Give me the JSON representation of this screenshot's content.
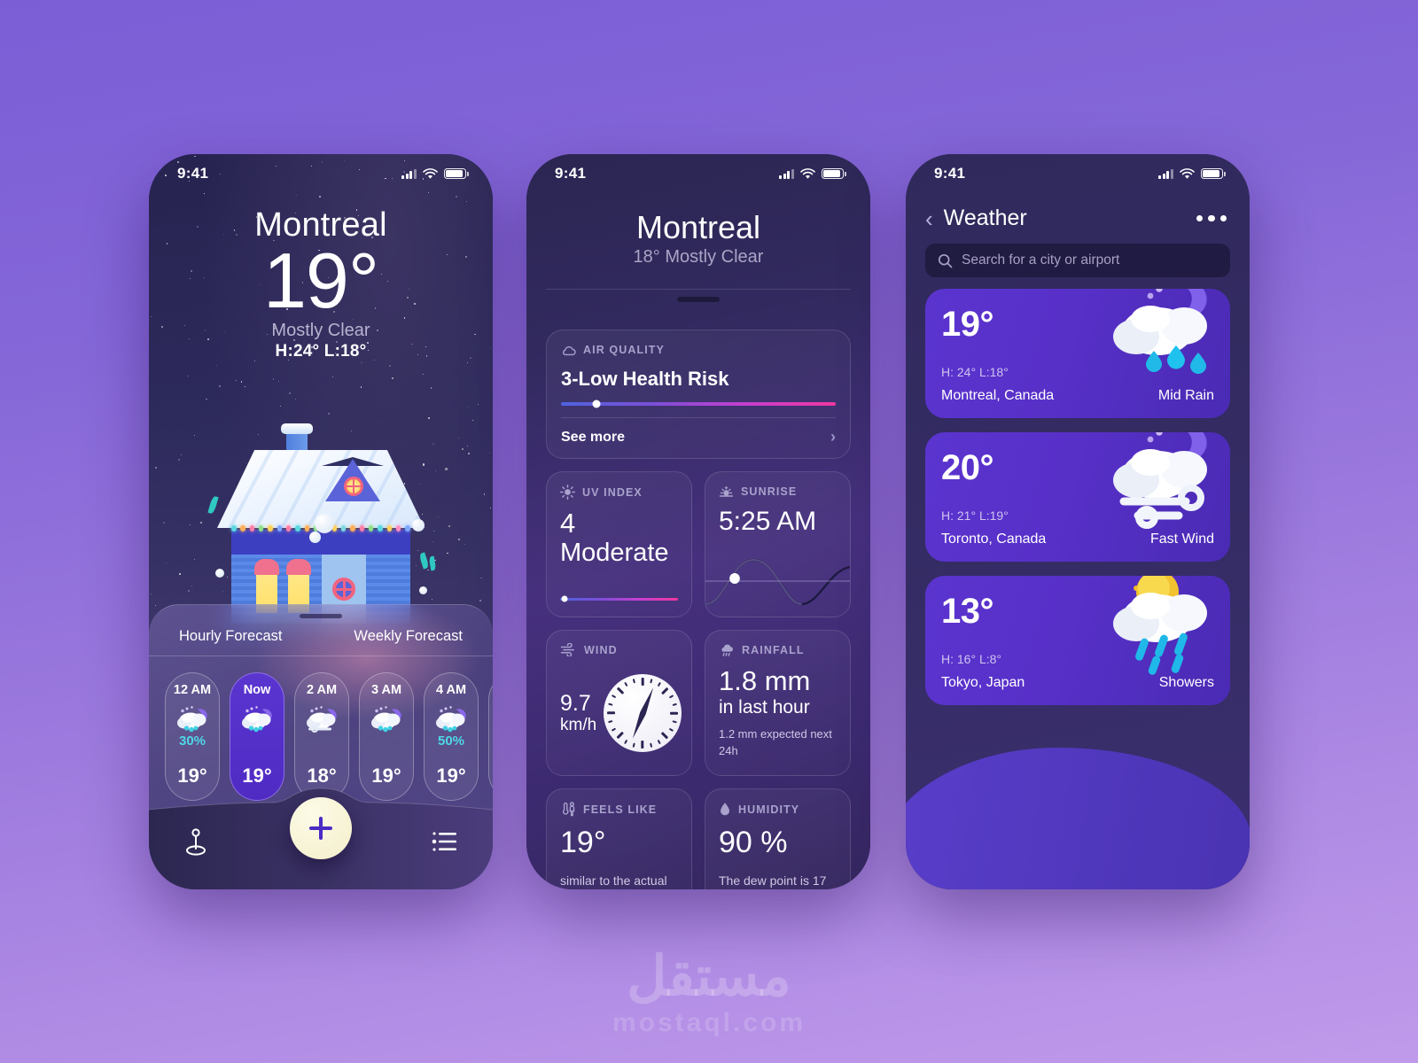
{
  "meta": {
    "background_top": "#7b5ed6",
    "background_bottom": "#c09aea",
    "accent_purple": "#5a35cf",
    "accent_cyan": "#4fd8e8"
  },
  "watermark": {
    "arabic": "مستقل",
    "latin": "mostaql.com"
  },
  "statusbar": {
    "time": "9:41",
    "signal_icon": "cellular-signal-icon",
    "wifi_icon": "wifi-icon",
    "battery_icon": "battery-icon"
  },
  "phone1": {
    "city": "Montreal",
    "temperature": "19°",
    "condition": "Mostly Clear",
    "high_low": "H:24°  L:18°",
    "tabs": {
      "hourly": "Hourly Forecast",
      "weekly": "Weekly Forecast"
    },
    "hours": [
      {
        "label": "12 AM",
        "icon": "cloud-snow-moon-icon",
        "pct": "30%",
        "temp": "19°",
        "active": false
      },
      {
        "label": "Now",
        "icon": "cloud-snow-moon-icon",
        "pct": "",
        "temp": "19°",
        "active": true
      },
      {
        "label": "2 AM",
        "icon": "cloud-fog-moon-icon",
        "pct": "",
        "temp": "18°",
        "active": false
      },
      {
        "label": "3 AM",
        "icon": "cloud-snow-moon-icon",
        "pct": "",
        "temp": "19°",
        "active": false
      },
      {
        "label": "4 AM",
        "icon": "cloud-snow-moon-icon",
        "pct": "50%",
        "temp": "19°",
        "active": false
      },
      {
        "label": "",
        "icon": "cloud-snow-moon-icon",
        "pct": "",
        "temp": "",
        "active": false
      }
    ],
    "nav": {
      "location_icon": "location-pin-icon",
      "add_icon": "plus-icon",
      "list_icon": "list-icon"
    }
  },
  "phone2": {
    "city": "Montreal",
    "subtitle": "18° Mostly Clear",
    "air_quality": {
      "label": "AIR QUALITY",
      "icon": "cloud-outline-icon",
      "value": "3-Low Health Risk",
      "bar_position_pct": 13,
      "see_more": "See more",
      "chevron_icon": "chevron-right-icon"
    },
    "metrics": [
      {
        "label": "UV INDEX",
        "icon": "sun-icon",
        "big": "4",
        "big2": "Moderate",
        "note": "",
        "bar_position_pct": 4
      },
      {
        "label": "SUNRISE",
        "icon": "sunrise-icon",
        "big": "5:25 AM",
        "big2": "",
        "note": ""
      },
      {
        "label": "WIND",
        "icon": "wind-icon",
        "big": "9.7",
        "small": "km/h",
        "note": ""
      },
      {
        "label": "RAINFALL",
        "icon": "rain-cloud-icon",
        "big": "1.8 mm",
        "big2": "in last hour",
        "note": "1.2 mm expected next  24h"
      },
      {
        "label": "FEELS LIKE",
        "icon": "thermometer-person-icon",
        "big": "19°",
        "note": "similar to the actual"
      },
      {
        "label": "HUMIDITY",
        "icon": "droplet-icon",
        "big": "90 %",
        "note": "The dew point is 17"
      }
    ]
  },
  "phone3": {
    "back_icon": "chevron-left-icon",
    "title": "Weather",
    "menu_icon": "more-horizontal-icon",
    "search": {
      "icon": "search-icon",
      "placeholder": "Search for a city or airport",
      "value": ""
    },
    "cities": [
      {
        "temp": "19°",
        "high_low": "H: 24°  L:18°",
        "name": "Montreal, Canada",
        "condition": "Mid Rain",
        "icon": "rain-cloud-moon-icon"
      },
      {
        "temp": "20°",
        "high_low": "H: 21°  L:19°",
        "name": "Toronto, Canada",
        "condition": "Fast Wind",
        "icon": "wind-cloud-moon-icon"
      },
      {
        "temp": "13°",
        "high_low": "H: 16°  L:8°",
        "name": "Tokyo, Japan",
        "condition": "Showers",
        "icon": "sun-rain-cloud-icon"
      }
    ]
  }
}
